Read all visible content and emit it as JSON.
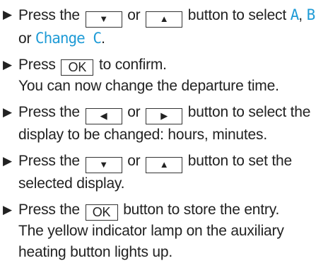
{
  "colors": {
    "text": "#222222",
    "display_text": "#1f9bd6"
  },
  "bullet_glyph": "▶",
  "keys": {
    "down": "▼",
    "up": "▲",
    "left": "◀",
    "right": "▶",
    "ok": "OK"
  },
  "steps": [
    {
      "p1": "Press the",
      "p2": "or",
      "p3": "button to select",
      "opt_a": "A",
      "sep1": ",",
      "opt_b": "B",
      "p4": "or",
      "opt_c": "Change C",
      "end": "."
    },
    {
      "p1": "Press",
      "p2": "to confirm.",
      "line2": "You can now change the departure time."
    },
    {
      "p1": "Press the",
      "p2": "or",
      "p3": "button to select the display to be changed: hours, minutes."
    },
    {
      "p1": "Press the",
      "p2": "or",
      "p3": "button to set the selected display."
    },
    {
      "p1": "Press the",
      "p2": "button to store the entry.",
      "line2": "The yellow indicator lamp on the auxiliary heating button lights up."
    }
  ]
}
